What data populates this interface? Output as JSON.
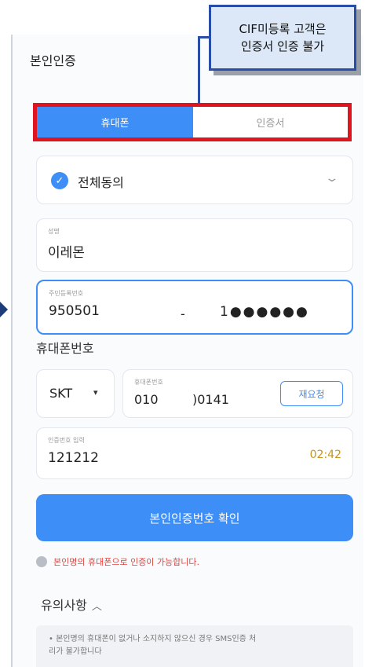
{
  "callout": {
    "line1": "CIF미등록 고객은",
    "line2": "인증서 인증 불가"
  },
  "header": {
    "title": "본인인증"
  },
  "tabs": [
    {
      "label": "휴대폰"
    },
    {
      "label": "인증서"
    }
  ],
  "agree": {
    "label": "전체동의"
  },
  "name_field": {
    "label": "성명",
    "value": "이레몬"
  },
  "rrn_field": {
    "label": "주민등록번호",
    "front": "950501",
    "dash": "-",
    "back": "1●●●●●●"
  },
  "phone_section": {
    "label": "휴대폰번호"
  },
  "carrier": {
    "value": "SKT"
  },
  "phone_number": {
    "label": "휴대폰번호",
    "part1": "010",
    "part2": ")0141"
  },
  "resend_button": {
    "label": "재요청"
  },
  "code_field": {
    "label": "인증번호 입력",
    "value": "121212",
    "timer": "02:42"
  },
  "confirm_button": {
    "label": "본인인증번호 확인"
  },
  "notice": {
    "text": "본인명의 휴대폰으로 인증이 가능합니다."
  },
  "caution": {
    "title": "유의사항",
    "line1": "• 본인명의 휴대폰이 없거나 소지하지 않으신 경우 SMS인증 처",
    "line2": "리가 불가합니다"
  },
  "colors": {
    "primary": "#3e8ef7",
    "highlight_border": "#e0141e",
    "callout_border": "#2a4ea8",
    "timer": "#c8941a",
    "notice": "#e0443e"
  }
}
